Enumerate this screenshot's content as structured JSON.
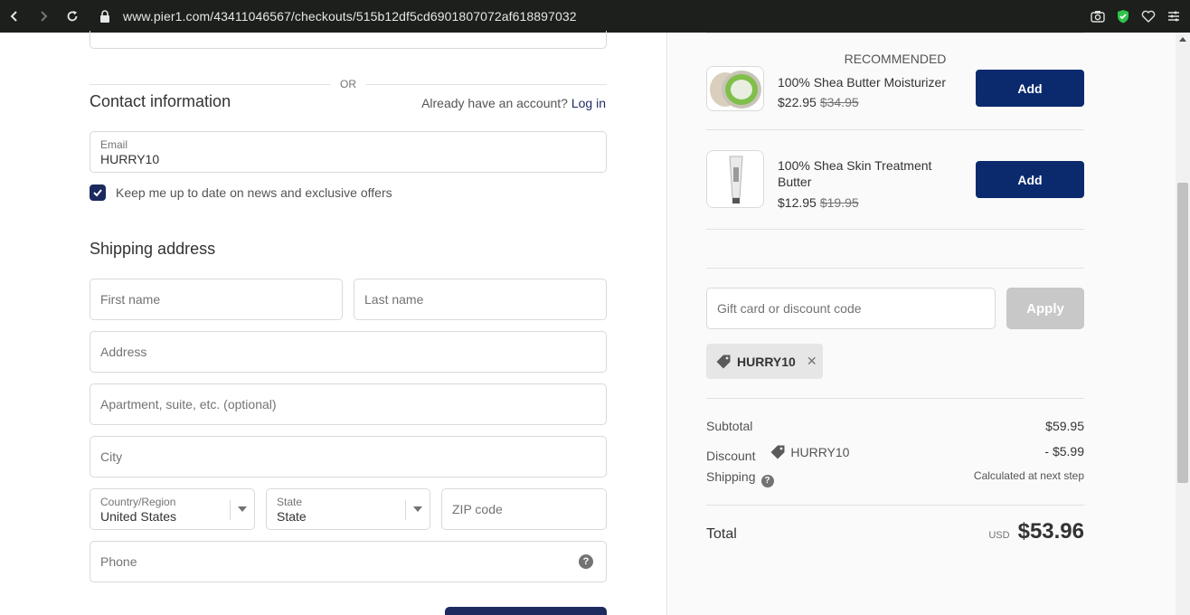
{
  "browser": {
    "url": "www.pier1.com/43411046567/checkouts/515b12df5cd6901807072af618897032"
  },
  "form": {
    "or_label": "OR",
    "contact_title": "Contact information",
    "account_prompt": "Already have an account?",
    "login_label": "Log in",
    "email_label": "Email",
    "email_value": "HURRY10",
    "newsletter_label": "Keep me up to date on news and exclusive offers",
    "newsletter_checked": true,
    "shipping_title": "Shipping address",
    "first_name_placeholder": "First name",
    "last_name_placeholder": "Last name",
    "address_placeholder": "Address",
    "apartment_placeholder": "Apartment, suite, etc. (optional)",
    "city_placeholder": "City",
    "country_label": "Country/Region",
    "country_value": "United States",
    "state_label": "State",
    "state_value": "State",
    "zip_placeholder": "ZIP code",
    "phone_placeholder": "Phone",
    "help_glyph": "?"
  },
  "sidebar": {
    "recommended_title": "RECOMMENDED",
    "items": [
      {
        "name": "100% Shea Butter Moisturizer",
        "price": "$22.95",
        "original_price": "$34.95",
        "add_label": "Add"
      },
      {
        "name": "100% Shea Skin Treatment Butter",
        "price": "$12.95",
        "original_price": "$19.95",
        "add_label": "Add"
      }
    ],
    "gift_placeholder": "Gift card or discount code",
    "apply_label": "Apply",
    "applied_code": "HURRY10",
    "remove_glyph": "✕",
    "summary": {
      "subtotal_label": "Subtotal",
      "subtotal_value": "$59.95",
      "discount_label": "Discount",
      "discount_code": "HURRY10",
      "discount_value": "- $5.99",
      "shipping_label": "Shipping",
      "shipping_value": "Calculated at next step",
      "total_label": "Total",
      "currency": "USD",
      "total_value": "$53.96"
    }
  },
  "colors": {
    "brand_navy": "#0b2a6e",
    "checkbox_navy": "#1c2a5f",
    "apply_disabled": "#c8c8c8"
  }
}
